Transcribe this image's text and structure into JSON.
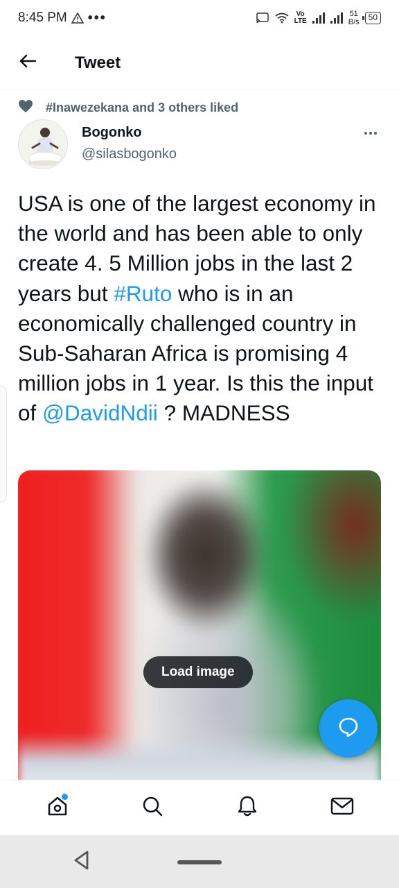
{
  "status_bar": {
    "time": "8:45 PM",
    "more_indicator": "•••",
    "lte_top": "Vo",
    "lte_bottom": "LTE",
    "net_speed_value": "51",
    "net_speed_unit": "B/s",
    "battery_level": "50"
  },
  "header": {
    "title": "Tweet",
    "back_icon": "arrow-left-icon"
  },
  "social_context": {
    "text": "#Inawezekana and 3 others liked",
    "icon": "heart-icon"
  },
  "author": {
    "name": "Bogonko",
    "handle": "@silasbogonko",
    "more_icon": "more-horizontal-icon"
  },
  "tweet": {
    "text_part1": "USA is one of the largest economy in the world and has been able to only create  4. 5 Million jobs in the last 2 years but ",
    "hashtag": "#Ruto",
    "text_part2": " who is in an economically challenged country in Sub-Saharan Africa is promising 4 million jobs in 1 year. Is this the input of ",
    "mention": "@DavidNdii",
    "text_part3": " ? MADNESS"
  },
  "media": {
    "load_label": "Load image"
  },
  "fab": {
    "icon": "reply-bubble-icon"
  },
  "bottom_nav": {
    "items": [
      "home-icon",
      "search-icon",
      "notifications-bell-icon",
      "messages-envelope-icon"
    ]
  },
  "colors": {
    "accent": "#1d9bf0",
    "text_primary": "#0f1419",
    "text_secondary": "#536471"
  }
}
